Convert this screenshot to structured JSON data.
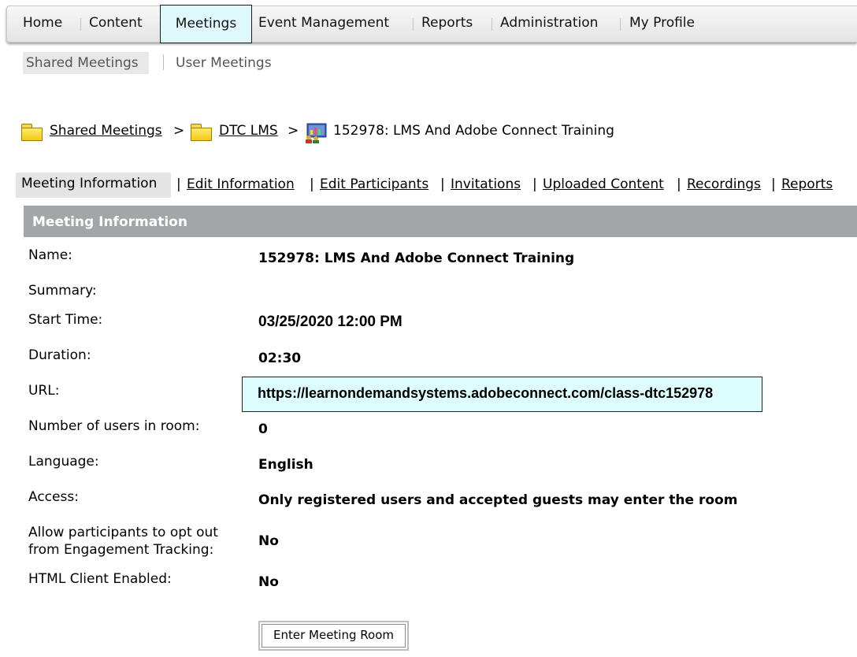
{
  "topnav": {
    "items": [
      "Home",
      "Content",
      "Meetings",
      "Event Management",
      "Reports",
      "Administration",
      "My Profile"
    ],
    "active": "Meetings"
  },
  "subnav": {
    "active": "Shared Meetings",
    "other": "User Meetings"
  },
  "breadcrumb": {
    "root": "Shared Meetings",
    "separator": ">",
    "folder": "DTC LMS",
    "current": "152978: LMS And Adobe Connect Training"
  },
  "tabs": {
    "active": "Meeting Information",
    "links": [
      "Edit Information",
      "Edit Participants",
      "Invitations",
      "Uploaded Content",
      "Recordings",
      "Reports"
    ],
    "separator": "|"
  },
  "section": {
    "title": "Meeting Information"
  },
  "fields": {
    "name_label": "Name:",
    "name_value": "152978: LMS And Adobe Connect Training",
    "summary_label": "Summary:",
    "start_label": "Start Time:",
    "start_value": "03/25/2020 12:00 PM",
    "duration_label": "Duration:",
    "duration_value": "02:30",
    "url_label": "URL:",
    "url_value": "https://learnondemandsystems.adobeconnect.com/class-dtc152978",
    "users_label": "Number of users in room:",
    "users_value": "0",
    "language_label": "Language:",
    "language_value": "English",
    "access_label": "Access:",
    "access_value": "Only registered users and accepted guests may enter the room",
    "optout_label_line1": "Allow participants to opt out",
    "optout_label_line2": "from Engagement Tracking:",
    "optout_value": "No",
    "html_client_label": "HTML Client Enabled:",
    "html_client_value": "No"
  },
  "actions": {
    "enter_room": "Enter Meeting Room"
  },
  "colors": {
    "active_tab_bg": "#dff8fb",
    "url_highlight": "#dcfcfe",
    "section_header": "#a3a6a9"
  }
}
